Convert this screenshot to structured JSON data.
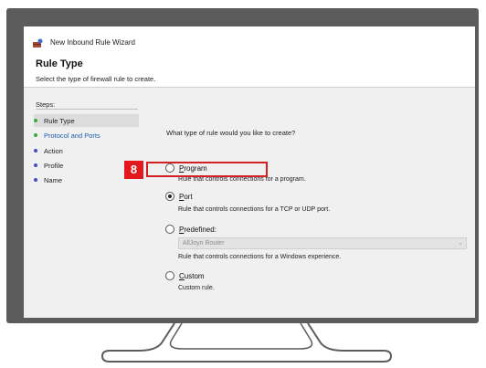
{
  "window": {
    "title": "New Inbound Rule Wizard"
  },
  "header": {
    "title": "Rule Type",
    "subtitle": "Select the type of firewall rule to create."
  },
  "steps": {
    "label": "Steps:",
    "items": [
      {
        "label": "Rule Type",
        "dot_color": "#3ea73e",
        "active": true
      },
      {
        "label": "Protocol and Ports",
        "dot_color": "#3ea73e",
        "link": true
      },
      {
        "label": "Action",
        "dot_color": "#4848c8"
      },
      {
        "label": "Profile",
        "dot_color": "#4848c8"
      },
      {
        "label": "Name",
        "dot_color": "#4848c8"
      }
    ]
  },
  "main": {
    "question": "What type of rule would you like to create?",
    "options": [
      {
        "label": "Program",
        "desc": "Rule that controls connections for a program.",
        "checked": false
      },
      {
        "label": "Port",
        "desc": "Rule that controls connections for a TCP or UDP port.",
        "checked": true
      },
      {
        "label": "Predefined:",
        "desc": "Rule that controls connections for a Windows experience.",
        "checked": false,
        "select_value": "AllJoyn Router"
      },
      {
        "label": "Custom",
        "desc": "Custom rule.",
        "checked": false
      }
    ]
  },
  "annotation": {
    "badge": "8",
    "color": "#e3191d"
  }
}
